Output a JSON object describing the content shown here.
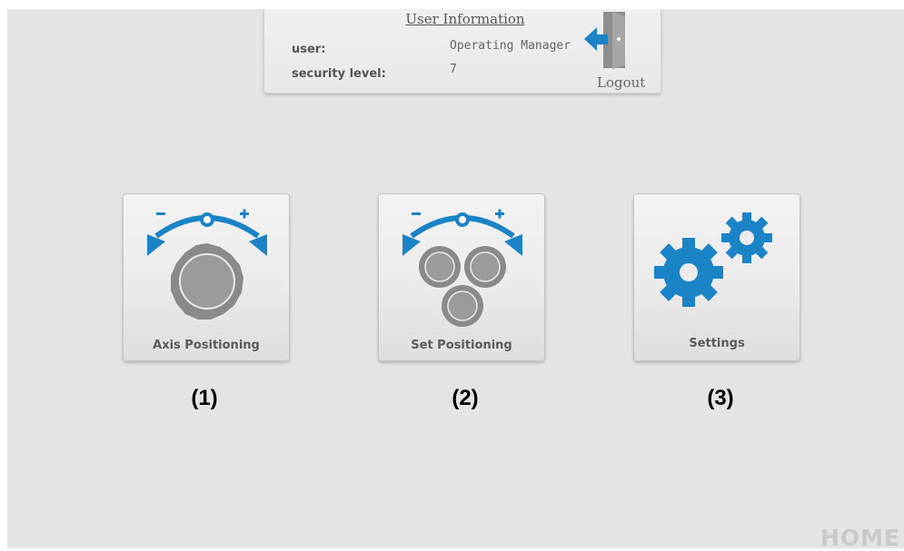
{
  "user_info": {
    "title": "User Information",
    "user_label": "user:",
    "user_value": "Operating Manager",
    "security_label": "security level:",
    "security_value": "7",
    "logout_label": "Logout"
  },
  "tiles": [
    {
      "label": "Axis Positioning",
      "icon": "axis-positioning-icon",
      "caption": "(1)"
    },
    {
      "label": "Set Positioning",
      "icon": "set-positioning-icon",
      "caption": "(2)"
    },
    {
      "label": "Settings",
      "icon": "gears-icon",
      "caption": "(3)"
    }
  ],
  "watermark": "HOME",
  "colors": {
    "accent_blue": "#1b84c6",
    "knob_gray": "#8e8e8e",
    "background": "#e4e4e4"
  }
}
